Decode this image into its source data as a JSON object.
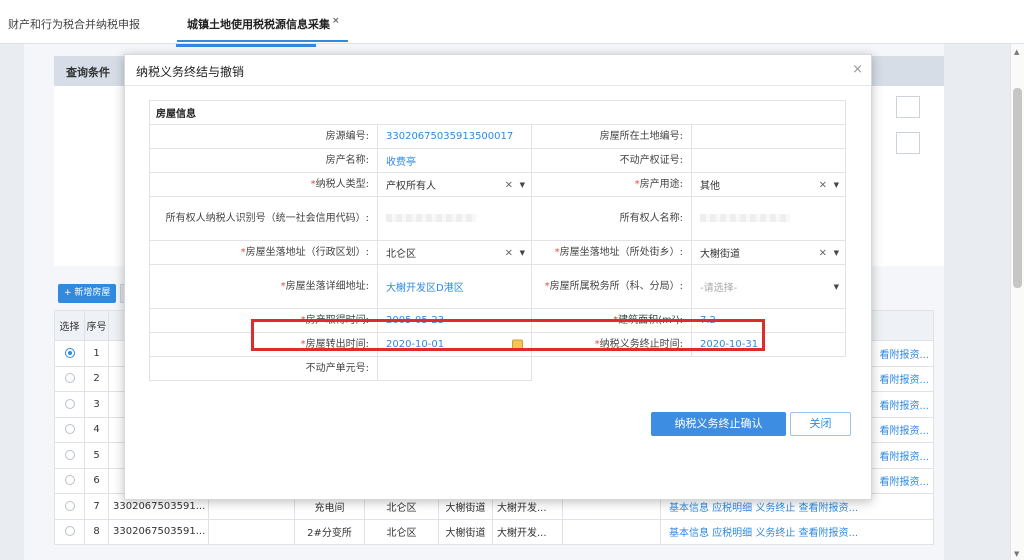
{
  "tabs": [
    {
      "label": "财产和行为税合并纳税申报"
    },
    {
      "label": "城镇土地使用税税源信息采集",
      "close": "×"
    }
  ],
  "query": {
    "title": "查询条件"
  },
  "add_button": "+ 新增房屋",
  "table": {
    "headers": [
      "选择",
      "序号"
    ],
    "rows": [
      {
        "no": "1",
        "selected": true,
        "code": "",
        "name": "",
        "district": "",
        "street": "",
        "dev": "",
        "ops": "看附报资..."
      },
      {
        "no": "2",
        "selected": false,
        "code": "",
        "name": "",
        "district": "",
        "street": "",
        "dev": "",
        "ops": "看附报资..."
      },
      {
        "no": "3",
        "selected": false,
        "code": "",
        "name": "",
        "district": "",
        "street": "",
        "dev": "",
        "ops": "看附报资..."
      },
      {
        "no": "4",
        "selected": false,
        "code": "",
        "name": "",
        "district": "",
        "street": "",
        "dev": "",
        "ops": "看附报资..."
      },
      {
        "no": "5",
        "selected": false,
        "code": "",
        "name": "",
        "district": "",
        "street": "",
        "dev": "",
        "ops": "看附报资..."
      },
      {
        "no": "6",
        "selected": false,
        "code": "",
        "name": "",
        "district": "",
        "street": "",
        "dev": "",
        "ops": "看附报资..."
      },
      {
        "no": "7",
        "selected": false,
        "code": "3302067503591...",
        "name": "充电间",
        "district": "北仑区",
        "street": "大榭街道",
        "dev": "大榭开发...",
        "ops": "基本信息 应税明细 义务终止 查看附报资..."
      },
      {
        "no": "8",
        "selected": false,
        "code": "3302067503591...",
        "name": "2#分变所",
        "district": "北仑区",
        "street": "大榭街道",
        "dev": "大榭开发...",
        "ops": "基本信息 应税明细 义务终止 查看附报资..."
      }
    ]
  },
  "modal": {
    "title": "纳税义务终结与撤销",
    "close": "×",
    "section": "房屋信息",
    "fields": {
      "house_id_label": "房源编号:",
      "house_id": "33020675035913500017",
      "land_no_label": "房屋所在土地编号:",
      "land_no": "",
      "house_name_label": "房产名称:",
      "house_name": "收费亭",
      "cert_label": "不动产权证号:",
      "cert": "",
      "taxpayer_type_label": "纳税人类型:",
      "taxpayer_type": "产权所有人",
      "use_label": "房产用途:",
      "use": "其他",
      "owner_id_label": "所有权人纳税人识别号（统一社会信用代码）:",
      "owner_name_label": "所有权人名称:",
      "district_label": "房屋坐落地址（行政区划）:",
      "district": "北仑区",
      "street_label": "房屋坐落地址（所处街乡）:",
      "street": "大榭街道",
      "address_label": "房屋坐落详细地址:",
      "address": "大榭开发区D港区",
      "tax_office_label": "房屋所属税务所（科、分局）:",
      "tax_office_placeholder": "-请选择-",
      "acquire_date_label": "房产取得时间:",
      "acquire_date": "2005-05-23",
      "area_label": "建筑面积(m²):",
      "area": "7.2",
      "transfer_date_label": "房屋转出时间:",
      "transfer_date": "2020-10-01",
      "end_date_label": "纳税义务终止时间:",
      "end_date": "2020-10-31",
      "unit_no_label": "不动产单元号:",
      "unit_no": ""
    },
    "confirm_button": "纳税义务终止确认",
    "close_button": "关闭",
    "required_mark": "*",
    "clear_mark": "×",
    "dropdown_arrow": "▼"
  }
}
